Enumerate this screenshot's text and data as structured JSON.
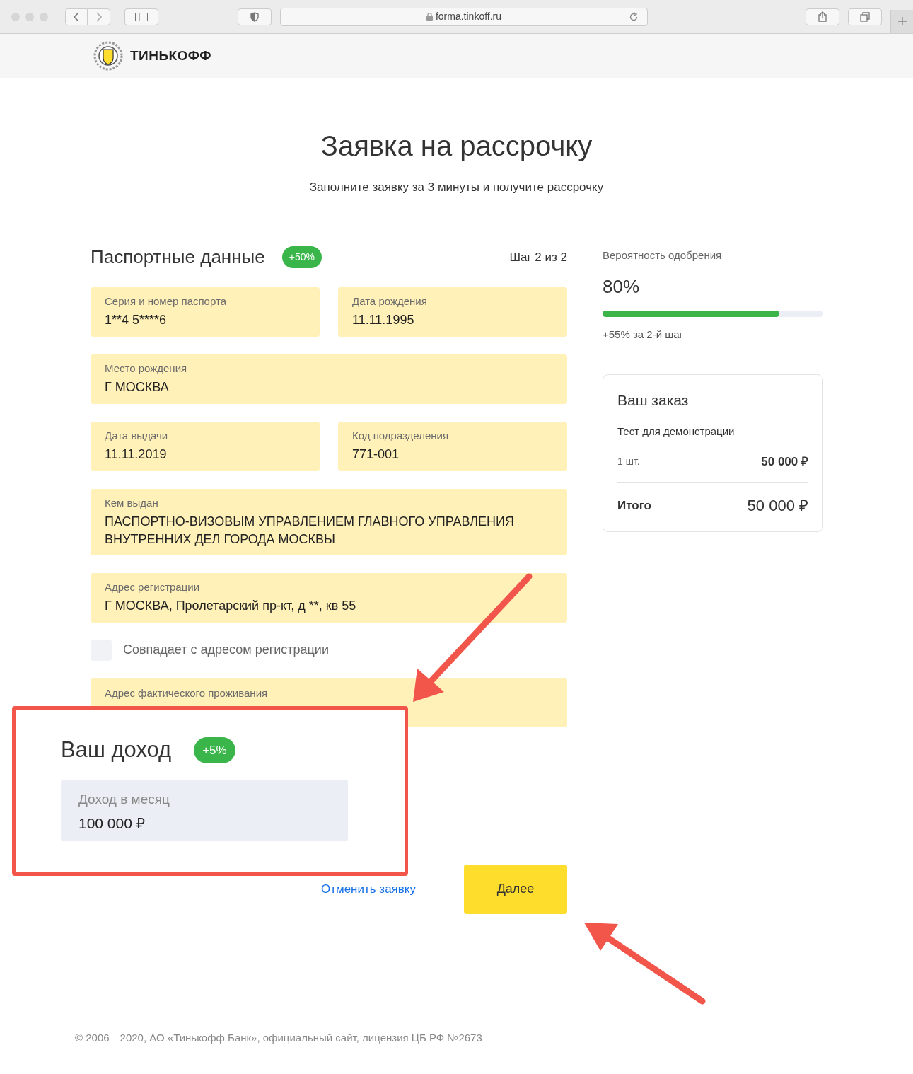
{
  "browser": {
    "url": "forma.tinkoff.ru"
  },
  "header": {
    "brand": "ТИНЬКОФФ"
  },
  "page": {
    "title": "Заявка на рассрочку",
    "subtitle": "Заполните заявку за 3 минуты и получите рассрочку"
  },
  "section": {
    "title": "Паспортные данные",
    "badge": "+50%",
    "step": "Шаг 2 из 2"
  },
  "field_rows": [
    [
      {
        "label": "Серия и номер паспорта",
        "value": "1**4 5****6"
      },
      {
        "label": "Дата рождения",
        "value": "11.11.1995"
      }
    ],
    [
      {
        "label": "Место рождения",
        "value": "Г МОСКВА"
      }
    ],
    [
      {
        "label": "Дата выдачи",
        "value": "11.11.2019"
      },
      {
        "label": "Код подразделения",
        "value": "771-001"
      }
    ],
    [
      {
        "label": "Кем выдан",
        "value": "ПАСПОРТНО-ВИЗОВЫМ УПРАВЛЕНИЕМ ГЛАВНОГО УПРАВЛЕНИЯ ВНУТРЕННИХ ДЕЛ ГОРОДА МОСКВЫ"
      }
    ],
    [
      {
        "label": "Адрес регистрации",
        "value": "Г МОСКВА, Пролетарский пр-кт, д **, кв 55"
      }
    ]
  ],
  "same_address": {
    "label": "Совпадает с адресом регистрации",
    "checked": false
  },
  "actual_address": {
    "label": "Адрес фактического проживания"
  },
  "income_callout": {
    "title": "Ваш доход",
    "badge": "+5%",
    "field": {
      "label": "Доход в месяц",
      "value": "100 000 ₽"
    }
  },
  "actions": {
    "cancel": "Отменить заявку",
    "next": "Далее"
  },
  "approval": {
    "label": "Вероятность одобрения",
    "value": "80%",
    "level": 0.8,
    "note": "+55% за 2-й шаг"
  },
  "order": {
    "title": "Ваш заказ",
    "item": "Тест для демонстрации",
    "qty": "1 шт.",
    "price": "50 000 ₽",
    "total_label": "Итого",
    "total": "50 000 ₽"
  },
  "footer": {
    "text": "© 2006—2020, АО «Тинькофф Банк», официальный сайт, лицензия ЦБ РФ №2673"
  }
}
